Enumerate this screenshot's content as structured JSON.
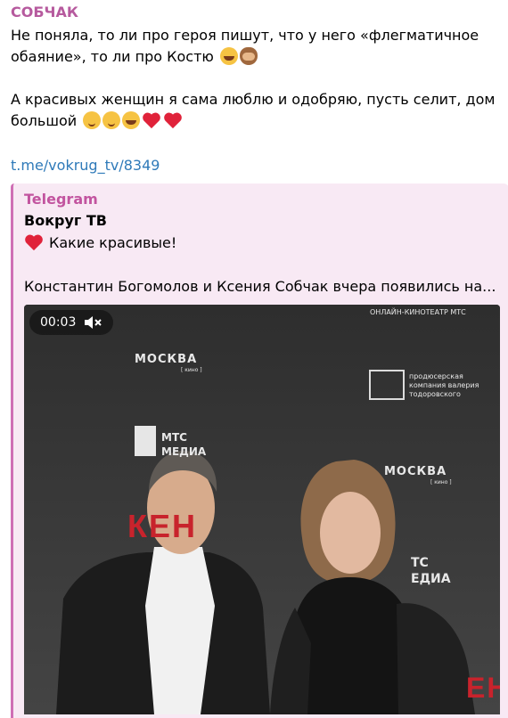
{
  "post": {
    "author": "СОБЧАК",
    "paragraph1": "Не поняла, то ли про героя пишут, что у него «флегматичное обаяние», то ли про Костю",
    "paragraph2": "А красивых женщин я сама люблю и одобряю, пусть селит, дом большой",
    "link": "t.me/vokrug_tv/8349"
  },
  "quote": {
    "source": "Telegram",
    "channel": "Вокруг ТВ",
    "line1": "Какие красивые!",
    "line2": "Константин Богомолов и Ксения Собчак вчера появились на..."
  },
  "video": {
    "time": "00:03",
    "backdrop": {
      "top_right": "ОНЛАЙН-КИНОТЕАТР МТС",
      "moskva": "МОСКВА",
      "kino": "[ кино ]",
      "producer": "продюсерская компания валерия тодоровского",
      "mts_left": "МТС",
      "media_left": "МЕДИА",
      "mts_right": "ТС",
      "media_right": "ЕДИА",
      "moskva2": "МОСКВА",
      "kino2": "[ кино ]",
      "red1": "КЕН",
      "red2": "ЕН"
    }
  },
  "colors": {
    "author": "#b65a9e",
    "link": "#2f7ab9",
    "quote_bg": "#f8e9f4",
    "quote_border": "#cf6fb5",
    "heart": "#e0223a"
  },
  "icons": {
    "emoji": [
      "laughing-emoji",
      "monkey-emoji",
      "wink-emoji",
      "heart-emoji"
    ],
    "video": [
      "muted-speaker-icon"
    ]
  }
}
